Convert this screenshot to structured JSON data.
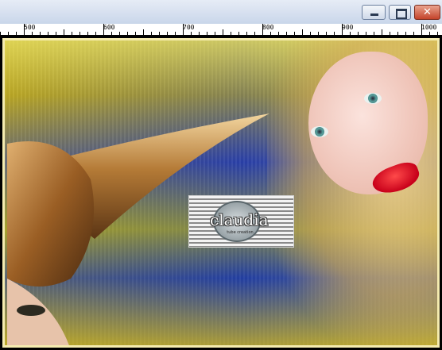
{
  "window": {
    "buttons": {
      "minimize": "minimize",
      "maximize": "maximize",
      "close": "✕"
    }
  },
  "ruler": {
    "labels": [
      "500",
      "600",
      "700",
      "800",
      "900",
      "1000"
    ]
  },
  "watermark": {
    "text": "claudia",
    "subtext": "tube creation"
  },
  "colors": {
    "frame": "#000000",
    "canvas_border": "#f5ecb0",
    "lips": "#d4001f",
    "titlebar": "#c9d6ea"
  }
}
